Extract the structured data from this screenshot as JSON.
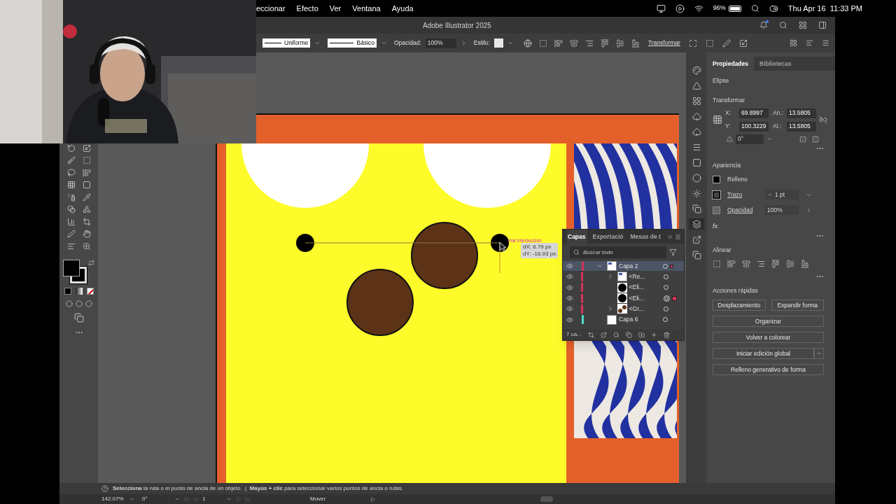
{
  "menu_bar": {
    "menus": [
      "eccionar",
      "Efecto",
      "Ver",
      "Ventana",
      "Ayuda"
    ],
    "battery": "96%",
    "clock": "Thu Apr 16  11:33 PM"
  },
  "window": {
    "title": "Adobe Illustrator 2025"
  },
  "control_bar": {
    "stroke_profile": "Uniforme",
    "brush": "Básico",
    "opacity_label": "Opacidad:",
    "opacity": "100%",
    "style_label": "Estilo:",
    "transform": "Transformar"
  },
  "canvas": {
    "smart_guide": "mar intersección",
    "measure": [
      "dX: 6.79 px",
      "dY: -16.93 px"
    ]
  },
  "layers_panel": {
    "tabs": [
      {
        "label": "Capas",
        "selected": true
      },
      {
        "label": "Exportació",
        "selected": false
      },
      {
        "label": "Mesas de t",
        "selected": false
      }
    ],
    "search_placeholder": "Buscar todo",
    "layers": [
      {
        "name": "Capa 2",
        "kind": "layer",
        "expanded": true,
        "selected": true,
        "targeted": false,
        "has_selection": true,
        "color": "#d4325a",
        "children": [
          {
            "name": "<Re...",
            "expanded": false,
            "selected": false,
            "targeted": false,
            "has_selection": false
          },
          {
            "name": "<Eli...",
            "kind": "ellipse",
            "selected": false,
            "targeted": false,
            "has_selection": false
          },
          {
            "name": "<Eli...",
            "kind": "ellipse",
            "selected": false,
            "targeted": true,
            "has_selection": true
          },
          {
            "name": "<Gr...",
            "kind": "group",
            "expanded": false,
            "selected": false,
            "targeted": false,
            "has_selection": false
          }
        ]
      },
      {
        "name": "Capa 6",
        "kind": "empty_layer",
        "selected": false,
        "targeted": false,
        "has_selection": false,
        "color": "#4fd8c4"
      }
    ],
    "count": "7 ca..."
  },
  "properties": {
    "tabs": [
      {
        "label": "Propiedades",
        "selected": true
      },
      {
        "label": "Bibliotecas",
        "selected": false
      }
    ],
    "object": "Elipse",
    "transform": {
      "title": "Transformar",
      "fields": [
        {
          "label": "X:",
          "value": "69.8997"
        },
        {
          "label": "An.:",
          "value": "13.5805"
        },
        {
          "label": "Y:",
          "value": "100.3229"
        },
        {
          "label": "Al.:",
          "value": "13.5805"
        }
      ],
      "angle": "0°"
    },
    "appearance": {
      "title": "Apariencia",
      "fill": "Relleno",
      "stroke": "Trazo",
      "stroke_weight": "1 pt",
      "opacity": "Opacidad",
      "opacity_value": "100%",
      "fx": "fx."
    },
    "align": {
      "title": "Alinear"
    },
    "quick_actions": {
      "title": "Acciones rápidas",
      "buttons": [
        {
          "label": "Desplazamiento",
          "kind": "half"
        },
        {
          "label": "Expandir forma",
          "kind": "half"
        },
        {
          "label": "Organizar",
          "kind": "full"
        },
        {
          "label": "Volver a colorear",
          "kind": "full"
        },
        {
          "label": "Iniciar edición global",
          "kind": "split"
        },
        {
          "label": "Relleno generativo de forma",
          "kind": "full"
        }
      ]
    }
  },
  "status_bar": {
    "hint": "**Selecciona** la ruta o el punto de ancla de un objeto.  |  **Mayús + clic** para seleccionar varios puntos de ancla o rutas.",
    "zoom": "142.07%",
    "rotation": "0°",
    "artboard": "1",
    "tool": "Mover"
  }
}
